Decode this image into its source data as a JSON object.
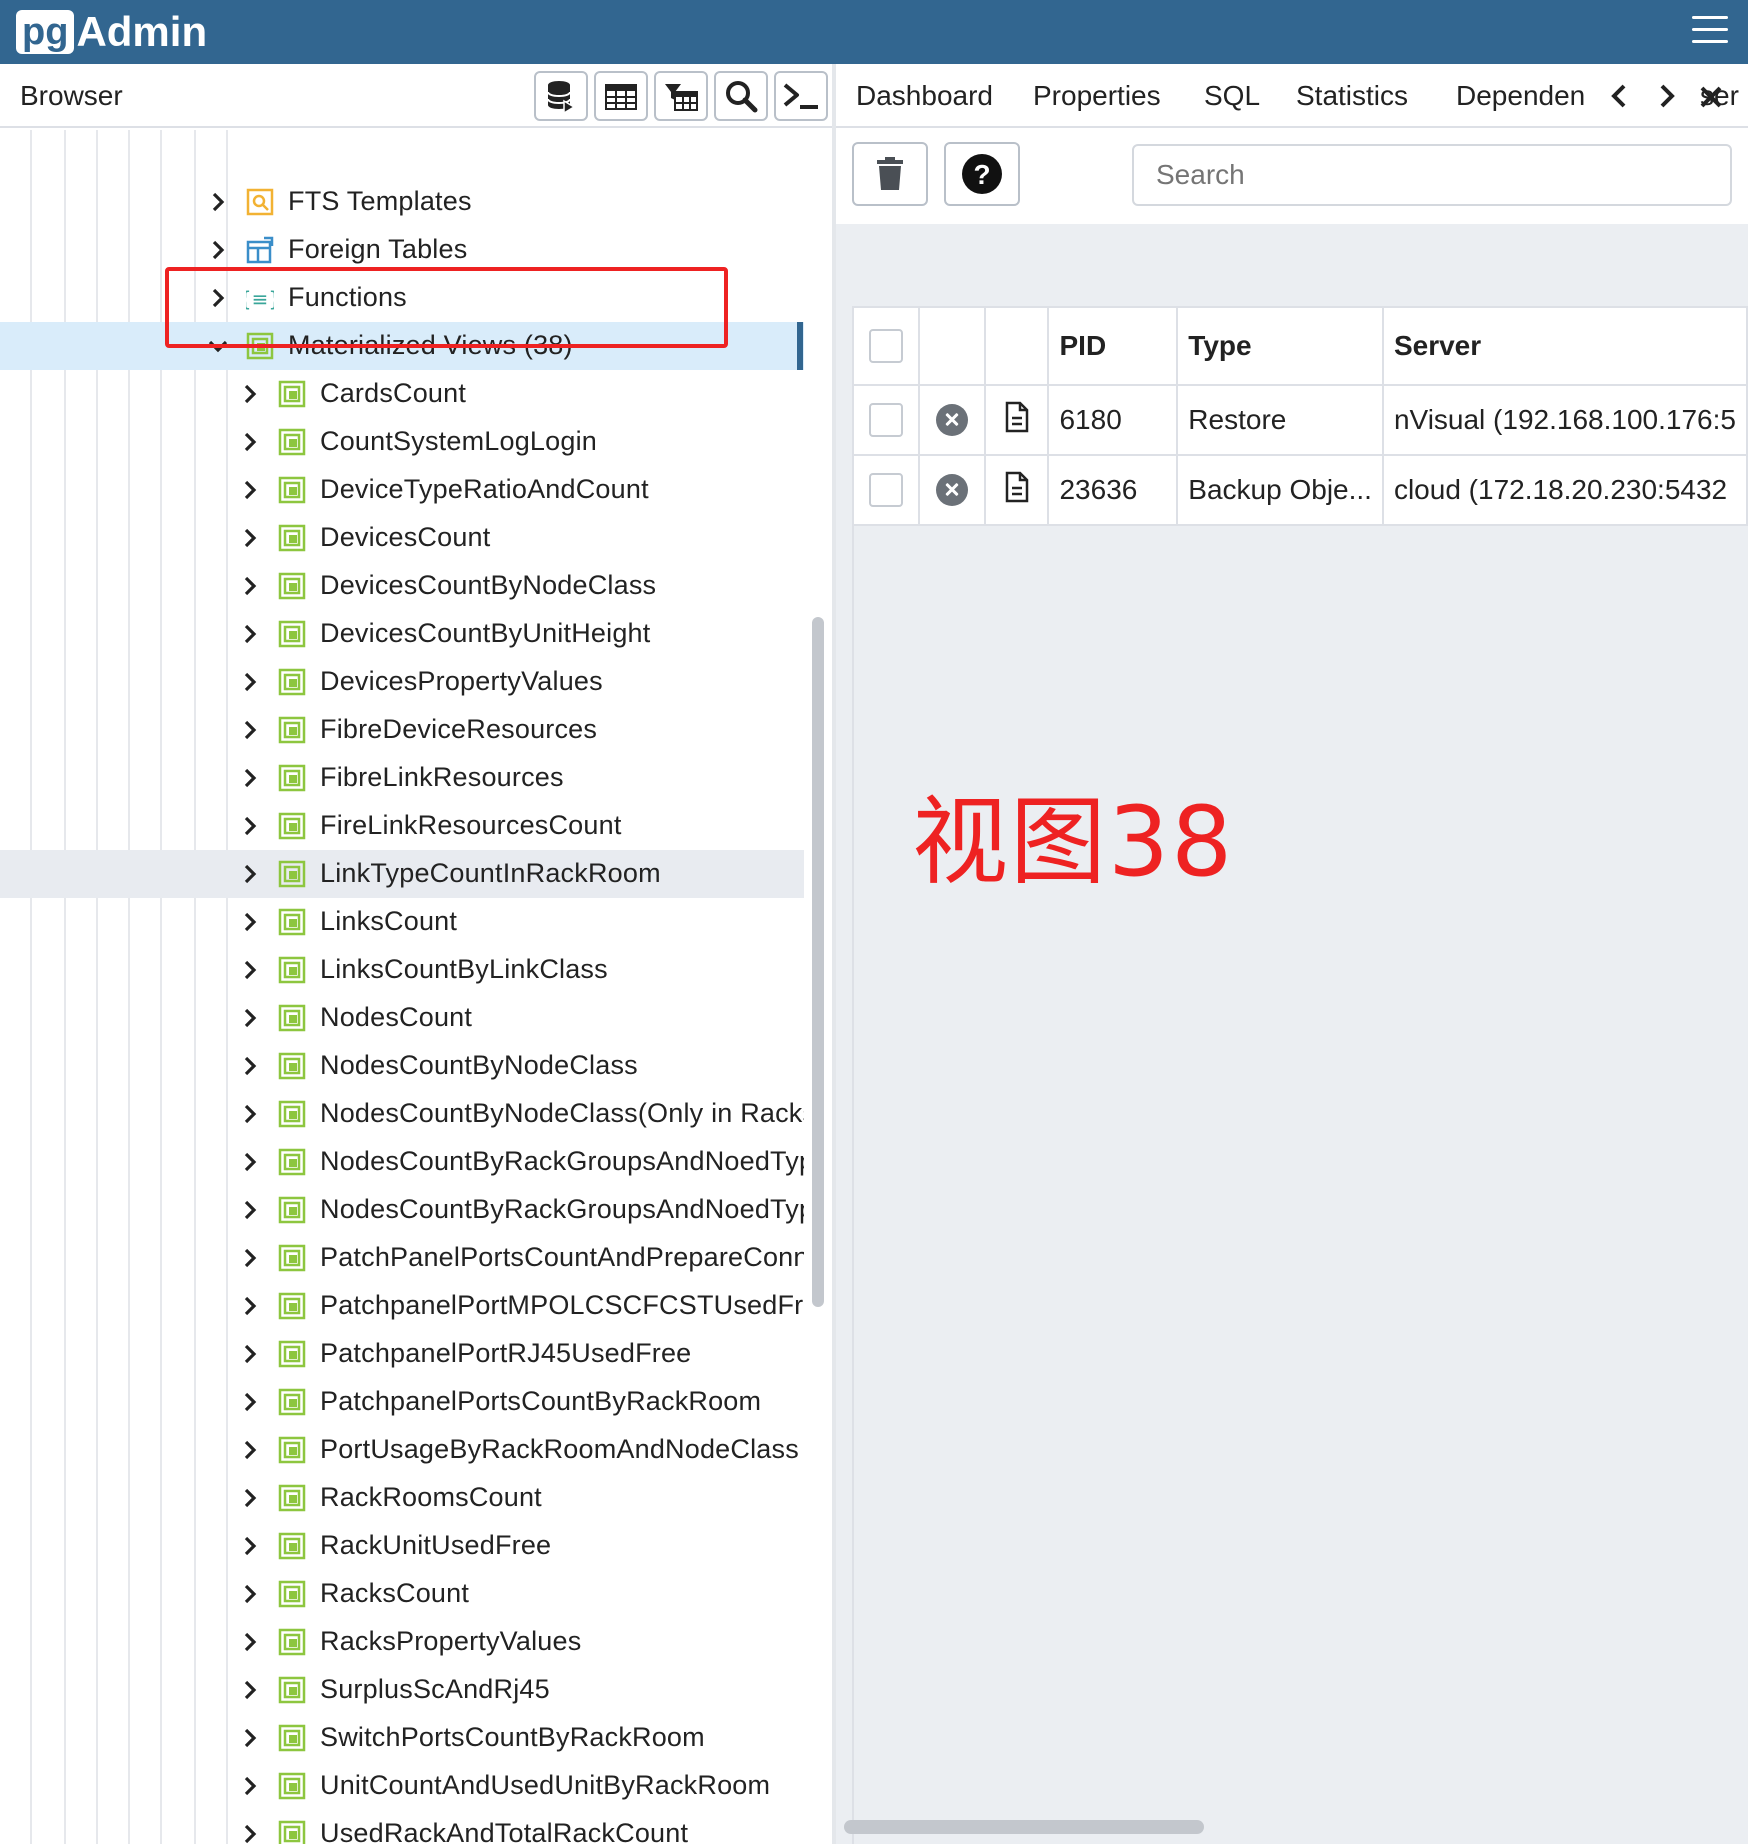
{
  "app": {
    "logo_pg": "pg",
    "logo_admin": "Admin"
  },
  "browser": {
    "title": "Browser",
    "toolbar_icons": [
      "database-icon",
      "table-icon",
      "filtered-rows-icon",
      "search-icon",
      "terminal-icon"
    ]
  },
  "tree": {
    "items": [
      {
        "label": "FTS Templates",
        "level": 1,
        "icon": "fts-template-icon",
        "expanded": false
      },
      {
        "label": "Foreign Tables",
        "level": 1,
        "icon": "foreign-table-icon",
        "expanded": false
      },
      {
        "label": "Functions",
        "level": 1,
        "icon": "function-icon",
        "expanded": false
      },
      {
        "label": "Materialized Views (38)",
        "level": 1,
        "icon": "materialized-view-icon",
        "expanded": true,
        "selected": true
      },
      {
        "label": "CardsCount",
        "level": 2,
        "icon": "materialized-view-icon"
      },
      {
        "label": "CountSystemLogLogin",
        "level": 2,
        "icon": "materialized-view-icon"
      },
      {
        "label": "DeviceTypeRatioAndCount",
        "level": 2,
        "icon": "materialized-view-icon"
      },
      {
        "label": "DevicesCount",
        "level": 2,
        "icon": "materialized-view-icon"
      },
      {
        "label": "DevicesCountByNodeClass",
        "level": 2,
        "icon": "materialized-view-icon"
      },
      {
        "label": "DevicesCountByUnitHeight",
        "level": 2,
        "icon": "materialized-view-icon"
      },
      {
        "label": "DevicesPropertyValues",
        "level": 2,
        "icon": "materialized-view-icon"
      },
      {
        "label": "FibreDeviceResources",
        "level": 2,
        "icon": "materialized-view-icon"
      },
      {
        "label": "FibreLinkResources",
        "level": 2,
        "icon": "materialized-view-icon"
      },
      {
        "label": "FireLinkResourcesCount",
        "level": 2,
        "icon": "materialized-view-icon"
      },
      {
        "label": "LinkTypeCountInRackRoom",
        "level": 2,
        "icon": "materialized-view-icon",
        "hover": true
      },
      {
        "label": "LinksCount",
        "level": 2,
        "icon": "materialized-view-icon"
      },
      {
        "label": "LinksCountByLinkClass",
        "level": 2,
        "icon": "materialized-view-icon"
      },
      {
        "label": "NodesCount",
        "level": 2,
        "icon": "materialized-view-icon"
      },
      {
        "label": "NodesCountByNodeClass",
        "level": 2,
        "icon": "materialized-view-icon"
      },
      {
        "label": "NodesCountByNodeClass(Only in Racks",
        "level": 2,
        "icon": "materialized-view-icon"
      },
      {
        "label": "NodesCountByRackGroupsAndNoedType",
        "level": 2,
        "icon": "materialized-view-icon"
      },
      {
        "label": "NodesCountByRackGroupsAndNoedType",
        "level": 2,
        "icon": "materialized-view-icon"
      },
      {
        "label": "PatchPanelPortsCountAndPrepareConne",
        "level": 2,
        "icon": "materialized-view-icon"
      },
      {
        "label": "PatchpanelPortMPOLCSCFCSTUsedFree",
        "level": 2,
        "icon": "materialized-view-icon"
      },
      {
        "label": "PatchpanelPortRJ45UsedFree",
        "level": 2,
        "icon": "materialized-view-icon"
      },
      {
        "label": "PatchpanelPortsCountByRackRoom",
        "level": 2,
        "icon": "materialized-view-icon"
      },
      {
        "label": "PortUsageByRackRoomAndNodeClass",
        "level": 2,
        "icon": "materialized-view-icon"
      },
      {
        "label": "RackRoomsCount",
        "level": 2,
        "icon": "materialized-view-icon"
      },
      {
        "label": "RackUnitUsedFree",
        "level": 2,
        "icon": "materialized-view-icon"
      },
      {
        "label": "RacksCount",
        "level": 2,
        "icon": "materialized-view-icon"
      },
      {
        "label": "RacksPropertyValues",
        "level": 2,
        "icon": "materialized-view-icon"
      },
      {
        "label": "SurplusScAndRj45",
        "level": 2,
        "icon": "materialized-view-icon"
      },
      {
        "label": "SwitchPortsCountByRackRoom",
        "level": 2,
        "icon": "materialized-view-icon"
      },
      {
        "label": "UnitCountAndUsedUnitByRackRoom",
        "level": 2,
        "icon": "materialized-view-icon"
      },
      {
        "label": "UsedRackAndTotalRackCount",
        "level": 2,
        "icon": "materialized-view-icon"
      }
    ]
  },
  "tabs": {
    "items": [
      "Dashboard",
      "Properties",
      "SQL",
      "Statistics",
      "Dependen"
    ],
    "overflow_label": "ser"
  },
  "processes": {
    "search_placeholder": "Search",
    "columns": [
      "PID",
      "Type",
      "Server"
    ],
    "rows": [
      {
        "pid": "6180",
        "type": "Restore",
        "server": "nVisual (192.168.100.176:5"
      },
      {
        "pid": "23636",
        "type": "Backup Obje...",
        "server": "cloud (172.18.20.230:5432"
      }
    ]
  },
  "annotation": {
    "text": "视图38",
    "color": "#ee2222"
  },
  "colors": {
    "header": "#326690",
    "selected_row": "#d9ecfa",
    "view_icon": "#8dc63f",
    "annotation": "#ee2222"
  }
}
